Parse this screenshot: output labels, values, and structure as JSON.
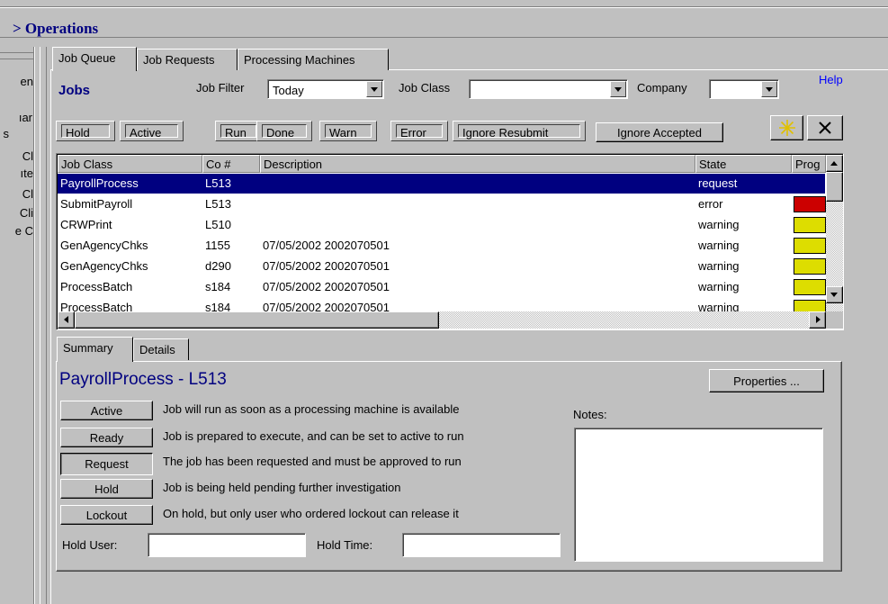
{
  "app": {
    "title": "> Operations"
  },
  "sidebar": {
    "items": [
      "en",
      "ıar",
      "s",
      "Cl",
      "ıte",
      "Cl",
      "Cli",
      "e C"
    ]
  },
  "tabs": [
    "Job Queue",
    "Job Requests",
    "Processing Machines"
  ],
  "jobs": {
    "title": "Jobs",
    "help": "Help",
    "job_filter_label": "Job Filter",
    "job_filter_value": "Today",
    "job_class_label": "Job Class",
    "job_class_value": "",
    "company_label": "Company",
    "company_value": ""
  },
  "filter_buttons": [
    "Hold",
    "Active",
    "Run",
    "Done",
    "Warn",
    "Error",
    "Ignore Resubmit",
    "Ignore Accepted"
  ],
  "toolbar_icons": [
    "new-star-icon",
    "delete-x-icon"
  ],
  "grid": {
    "columns": [
      "Job Class",
      "Co #",
      "Description",
      "State",
      "Prog"
    ],
    "rows": [
      {
        "job_class": "PayrollProcess",
        "co": "L513",
        "description": "",
        "state": "request",
        "progress_color": ""
      },
      {
        "job_class": "SubmitPayroll",
        "co": "L513",
        "description": "",
        "state": "error",
        "progress_color": "#cc0000"
      },
      {
        "job_class": "CRWPrint",
        "co": "L510",
        "description": "",
        "state": "warning",
        "progress_color": "#dddd00"
      },
      {
        "job_class": "GenAgencyChks",
        "co": "1155",
        "description": "07/05/2002 2002070501",
        "state": "warning",
        "progress_color": "#dddd00"
      },
      {
        "job_class": "GenAgencyChks",
        "co": "d290",
        "description": "07/05/2002 2002070501",
        "state": "warning",
        "progress_color": "#dddd00"
      },
      {
        "job_class": "ProcessBatch",
        "co": "s184",
        "description": "07/05/2002 2002070501",
        "state": "warning",
        "progress_color": "#dddd00"
      },
      {
        "job_class": "ProcessBatch",
        "co": "s184",
        "description": "07/05/2002 2002070501",
        "state": "warning",
        "progress_color": "#dddd00"
      }
    ]
  },
  "lower_tabs": [
    "Summary",
    "Details"
  ],
  "summary": {
    "job_title": "PayrollProcess - L513",
    "properties_button": "Properties ...",
    "notes_label": "Notes:",
    "notes_value": "",
    "states": [
      {
        "button": "Active",
        "desc": "Job will run as soon as a processing machine is available"
      },
      {
        "button": "Ready",
        "desc": "Job is prepared to execute, and can be set to active to run"
      },
      {
        "button": "Request",
        "desc": "The job has been requested and must be approved to run"
      },
      {
        "button": "Hold",
        "desc": "Job is being held pending further investigation"
      },
      {
        "button": "Lockout",
        "desc": "On hold, but only user who ordered lockout can release it"
      }
    ],
    "hold_user_label": "Hold User:",
    "hold_user_value": "",
    "hold_time_label": "Hold Time:",
    "hold_time_value": ""
  },
  "colors": {
    "title": "#000080",
    "selection": "#000080",
    "error": "#cc0000",
    "warning": "#dddd00",
    "link": "#0000ff"
  }
}
